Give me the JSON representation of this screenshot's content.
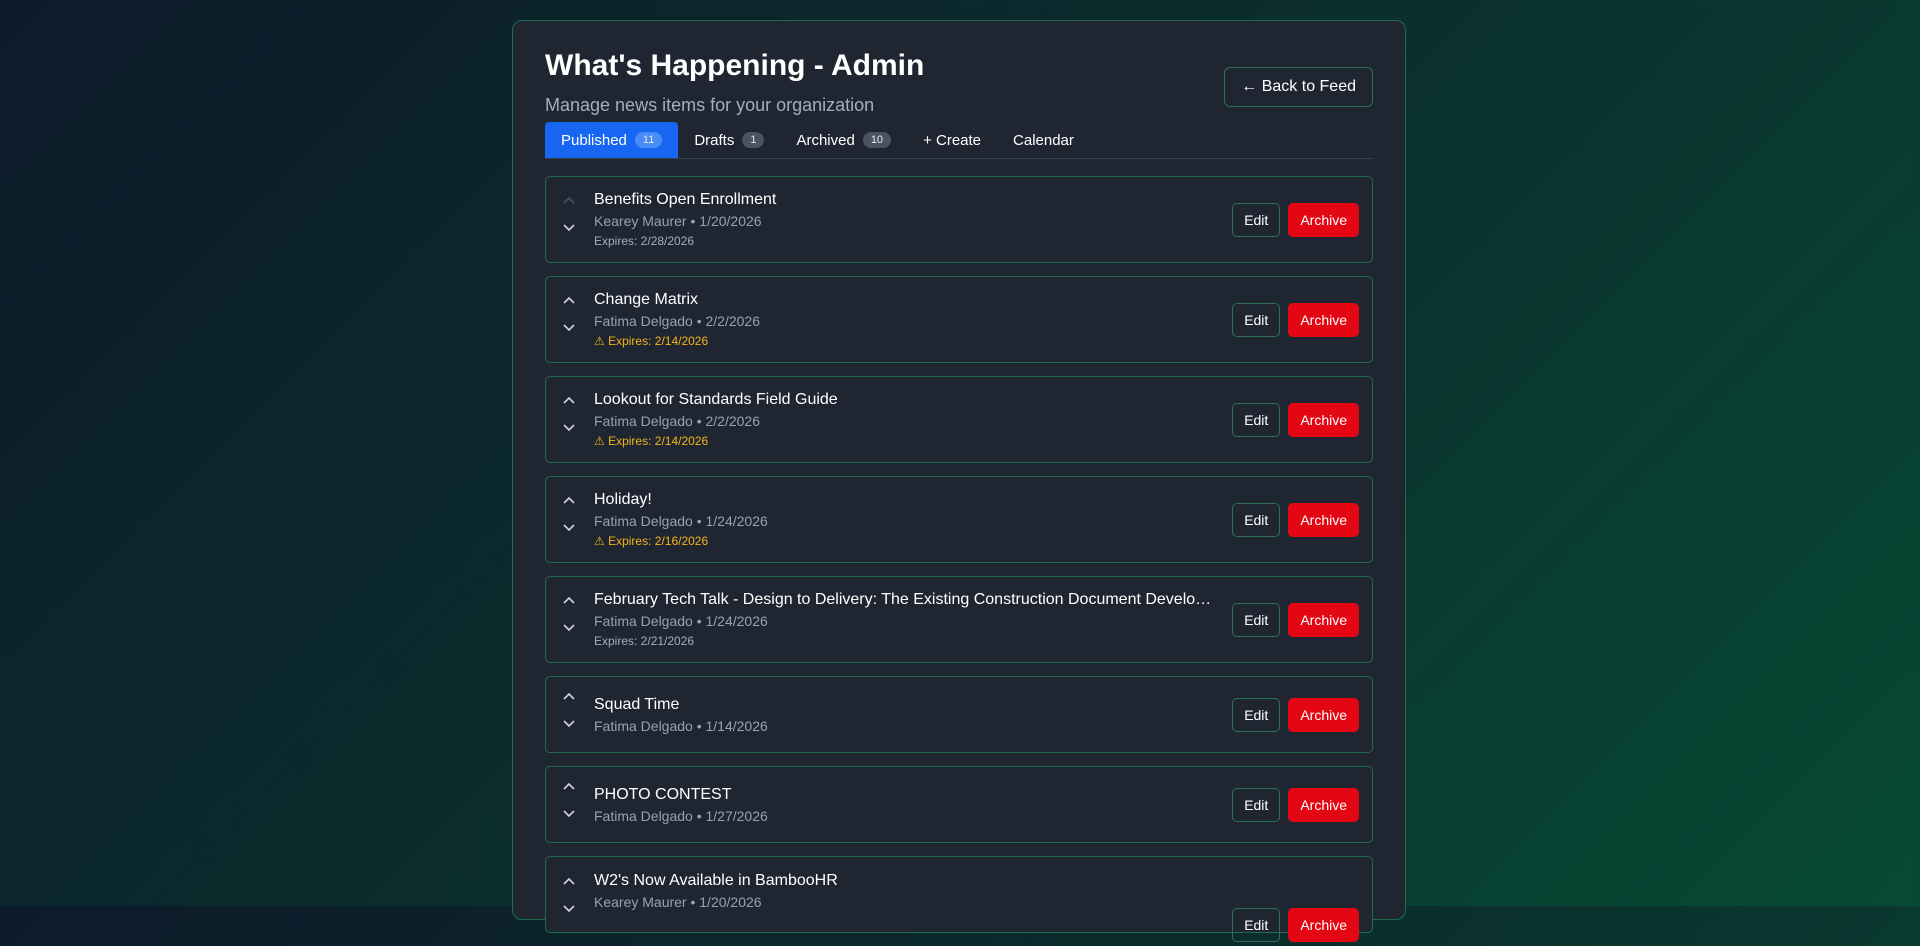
{
  "header": {
    "title": "What's Happening - Admin",
    "subtitle": "Manage news items for your organization",
    "back_label": "← Back to Feed"
  },
  "tabs": [
    {
      "label": "Published",
      "count": "11",
      "active": true
    },
    {
      "label": "Drafts",
      "count": "1"
    },
    {
      "label": "Archived",
      "count": "10"
    },
    {
      "label": "+ Create"
    },
    {
      "label": "Calendar"
    }
  ],
  "actions": {
    "edit_label": "Edit",
    "archive_label": "Archive"
  },
  "items": [
    {
      "title": "Benefits Open Enrollment",
      "meta": "Kearey Maurer • 1/20/2026",
      "expires": "Expires: 2/28/2026",
      "warn": false,
      "up_disabled": true
    },
    {
      "title": "Change Matrix",
      "meta": "Fatima Delgado • 2/2/2026",
      "expires": "⚠ Expires: 2/14/2026",
      "warn": true
    },
    {
      "title": "Lookout for Standards Field Guide",
      "meta": "Fatima Delgado • 2/2/2026",
      "expires": "⚠ Expires: 2/14/2026",
      "warn": true
    },
    {
      "title": "Holiday!",
      "meta": "Fatima Delgado • 1/24/2026",
      "expires": "⚠ Expires: 2/16/2026",
      "warn": true
    },
    {
      "title": "February Tech Talk - Design to Delivery: The Existing Construction Document Development Process",
      "meta": "Fatima Delgado • 1/24/2026",
      "expires": "Expires: 2/21/2026",
      "warn": false
    },
    {
      "title": "Squad Time",
      "meta": "Fatima Delgado • 1/14/2026"
    },
    {
      "title": "PHOTO CONTEST",
      "meta": "Fatima Delgado • 1/27/2026"
    },
    {
      "title": "W2's Now Available in BambooHR",
      "meta": "Kearey Maurer • 1/20/2026"
    }
  ],
  "colors": {
    "accent": "#1666f2",
    "archive": "#e40613",
    "warning": "#f5b418",
    "border": "#1f6b4e"
  },
  "icons": {
    "up": "chevron-up-icon",
    "down": "chevron-down-icon"
  }
}
